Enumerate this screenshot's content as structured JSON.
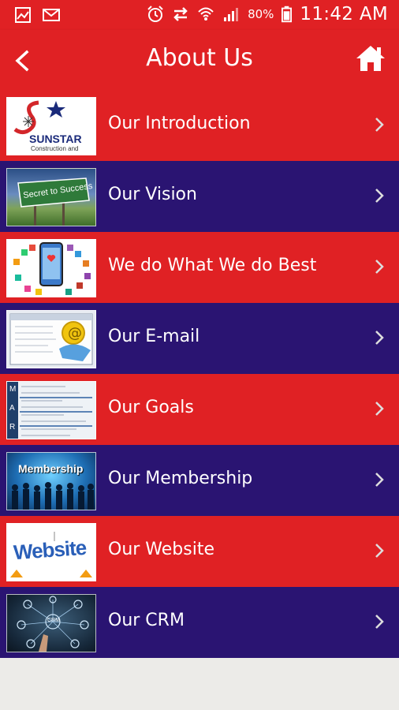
{
  "status_bar": {
    "battery_percent": "80%",
    "time": "11:42 AM",
    "icons": [
      "image-icon",
      "mail-icon",
      "alarm-icon",
      "sync-icon",
      "wifi-icon",
      "signal-icon",
      "battery-icon"
    ]
  },
  "header": {
    "title": "About Us",
    "back_icon": "back-arrow-icon",
    "home_icon": "home-icon"
  },
  "menu": {
    "items": [
      {
        "label": "Our Introduction",
        "thumb": "sunstar-logo",
        "thumb_text": "SUNSTAR",
        "thumb_subtext": "Construction and",
        "color": "#e02124"
      },
      {
        "label": "Our Vision",
        "thumb": "secret-to-success-sign",
        "thumb_text": "Secret to Success",
        "color": "#2a1472"
      },
      {
        "label": "We do What We do Best",
        "thumb": "phone-apps-graphic",
        "color": "#e02124"
      },
      {
        "label": "Our E-mail",
        "thumb": "email-window-graphic",
        "color": "#2a1472"
      },
      {
        "label": "Our Goals",
        "thumb": "smart-goals-chart",
        "thumb_letters": [
          "M",
          "A",
          "R"
        ],
        "color": "#e02124"
      },
      {
        "label": "Our Membership",
        "thumb": "membership-silhouettes",
        "thumb_text": "Membership",
        "color": "#2a1472"
      },
      {
        "label": "Our Website",
        "thumb": "website-word-graphic",
        "thumb_text": "Website",
        "color": "#e02124"
      },
      {
        "label": "Our CRM",
        "thumb": "crm-network-graphic",
        "thumb_text": "CRM",
        "color": "#2a1472"
      }
    ]
  },
  "colors": {
    "primary_red": "#e02124",
    "primary_blue": "#2a1472",
    "background": "#ecebe8"
  }
}
